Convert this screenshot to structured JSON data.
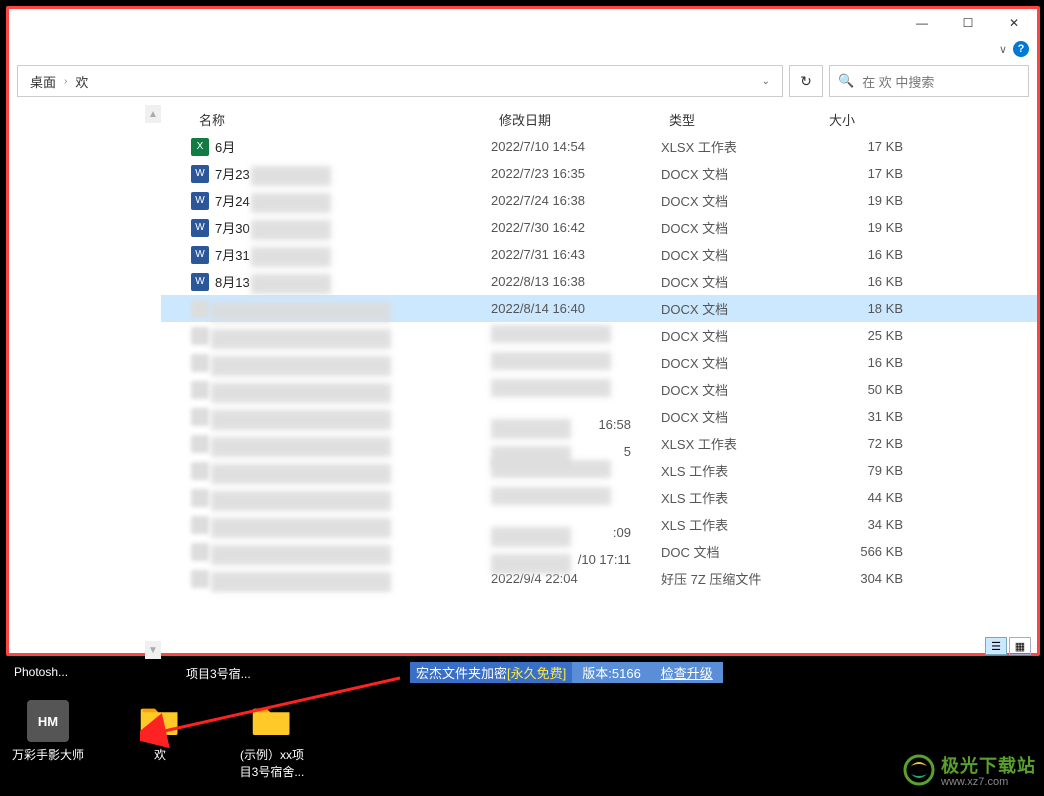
{
  "window": {
    "minimize": "—",
    "maximize": "☐",
    "close": "✕",
    "help": "?",
    "chevron": "∨"
  },
  "breadcrumb": {
    "part1": "桌面",
    "part2": "欢"
  },
  "refresh": "↻",
  "search": {
    "placeholder": "在 欢 中搜索"
  },
  "columns": {
    "name": "名称",
    "date": "修改日期",
    "type": "类型",
    "size": "大小"
  },
  "files": [
    {
      "icon": "xlsx",
      "name": "6月",
      "date": "2022/7/10 14:54",
      "type": "XLSX 工作表",
      "size": "17 KB",
      "blurName": false
    },
    {
      "icon": "docx",
      "name": "7月23",
      "date": "2022/7/23 16:35",
      "type": "DOCX 文档",
      "size": "17 KB",
      "blurName": true
    },
    {
      "icon": "docx",
      "name": "7月24",
      "date": "2022/7/24 16:38",
      "type": "DOCX 文档",
      "size": "19 KB",
      "blurName": true
    },
    {
      "icon": "docx",
      "name": "7月30",
      "date": "2022/7/30 16:42",
      "type": "DOCX 文档",
      "size": "19 KB",
      "blurName": true
    },
    {
      "icon": "docx",
      "name": "7月31",
      "date": "2022/7/31 16:43",
      "type": "DOCX 文档",
      "size": "16 KB",
      "blurName": true
    },
    {
      "icon": "docx",
      "name": "8月13",
      "date": "2022/8/13 16:38",
      "type": "DOCX 文档",
      "size": "16 KB",
      "blurName": true
    },
    {
      "icon": "blur",
      "name": "",
      "date": "2022/8/14 16:40",
      "type": "DOCX 文档",
      "size": "18 KB",
      "blurName": true,
      "selected": true
    },
    {
      "icon": "blur",
      "name": "",
      "date": "",
      "type": "DOCX 文档",
      "size": "25 KB",
      "blurName": true,
      "blurDate": true
    },
    {
      "icon": "blur",
      "name": "",
      "date": "",
      "type": "DOCX 文档",
      "size": "16 KB",
      "blurName": true,
      "blurDate": true
    },
    {
      "icon": "blur",
      "name": "",
      "date": "",
      "type": "DOCX 文档",
      "size": "50 KB",
      "blurName": true,
      "blurDate": true
    },
    {
      "icon": "blur",
      "name": "",
      "date": "16:58",
      "type": "DOCX 文档",
      "size": "31 KB",
      "blurName": true,
      "blurDate": true,
      "partialDate": true
    },
    {
      "icon": "blur",
      "name": "",
      "date": "5",
      "type": "XLSX 工作表",
      "size": "72 KB",
      "blurName": true,
      "blurDate": true,
      "partialDate": true
    },
    {
      "icon": "blur",
      "name": "",
      "date": "",
      "type": "XLS 工作表",
      "size": "79 KB",
      "blurName": true,
      "blurDate": true
    },
    {
      "icon": "blur",
      "name": "",
      "date": "",
      "type": "XLS 工作表",
      "size": "44 KB",
      "blurName": true,
      "blurDate": true
    },
    {
      "icon": "blur",
      "name": "",
      "date": ":09",
      "type": "XLS 工作表",
      "size": "34 KB",
      "blurName": true,
      "blurDate": true,
      "partialDate": true
    },
    {
      "icon": "blur",
      "name": "",
      "date": "/10 17:11",
      "type": "DOC 文档",
      "size": "566 KB",
      "blurName": true,
      "blurDate": true,
      "partialDate": true
    },
    {
      "icon": "blur",
      "name": "",
      "date": "2022/9/4 22:04",
      "type": "好压 7Z 压缩文件",
      "size": "304 KB",
      "blurName": true
    }
  ],
  "desktop": {
    "label1": "Photosh...",
    "label2": "项目3号宿...",
    "icons": [
      {
        "short": "HM",
        "label": "万彩手影大师"
      },
      {
        "short": "",
        "label": "欢"
      },
      {
        "short": "",
        "label": "(示例）xx项目3号宿舍..."
      }
    ]
  },
  "statusbar": {
    "title": "宏杰文件夹加密",
    "free": "[永久免费]",
    "version_label": "版本:",
    "version": "5166",
    "upgrade": "检查升级"
  },
  "watermark": {
    "text": "极光下载站",
    "sub": "www.xz7.com"
  }
}
